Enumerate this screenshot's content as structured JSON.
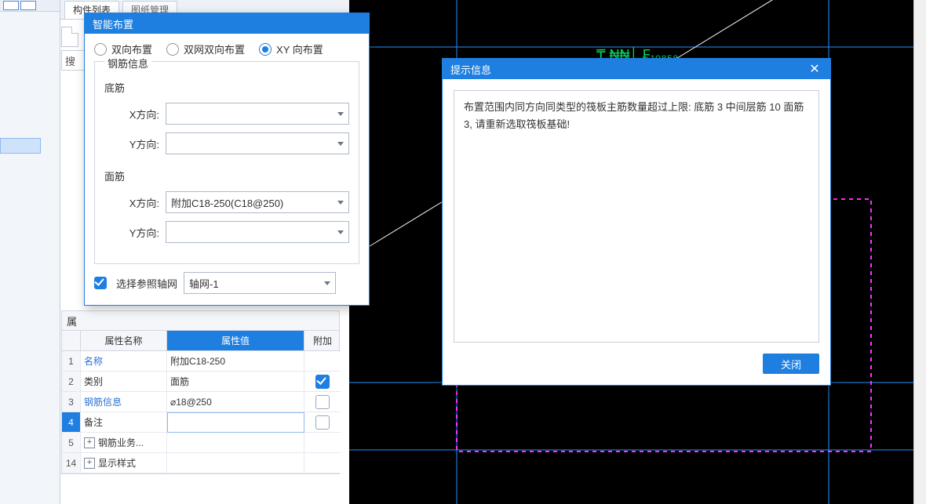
{
  "tabs": {
    "components": "构件列表",
    "drawingMgmt": "图纸管理"
  },
  "search_stub": "搜",
  "dialog1": {
    "title": "智能布置",
    "radios": {
      "bi": "双向布置",
      "meshbi": "双网双向布置",
      "xy": "XY 向布置"
    },
    "fieldset_legend": "钢筋信息",
    "bottom_label": "底筋",
    "top_label": "面筋",
    "xdir": "X方向:",
    "ydir": "Y方向:",
    "top_x_value": "附加C18-250(C18@250)",
    "axis_check": "选择参照轴网",
    "axis_value": "轴网-1"
  },
  "propheader": "属",
  "propcols": {
    "name": "属性名称",
    "value": "属性值",
    "extra": "附加"
  },
  "rows": [
    {
      "n": "1",
      "name": "名称",
      "value": "附加C18-250",
      "link": true
    },
    {
      "n": "2",
      "name": "类别",
      "value": "面筋",
      "chk": true
    },
    {
      "n": "3",
      "name": "钢筋信息",
      "value": "⌀18@250",
      "link": true,
      "chk": false
    },
    {
      "n": "4",
      "name": "备注",
      "value": "",
      "sel": true,
      "chk": false
    },
    {
      "n": "5",
      "name": "钢筋业务...",
      "value": "",
      "expand": true
    },
    {
      "n": "14",
      "name": "显示样式",
      "value": "",
      "expand": true
    }
  ],
  "dialog2": {
    "title": "提示信息",
    "message": "布置范围内同方向同类型的筏板主筋数量超过上限: 底筋 3 中间层筋 10 面筋 3, 请重新选取筏板基础!",
    "close": "关闭"
  },
  "cad_text": "₸   ₦₦│ ₣₁₀₈₅₈"
}
